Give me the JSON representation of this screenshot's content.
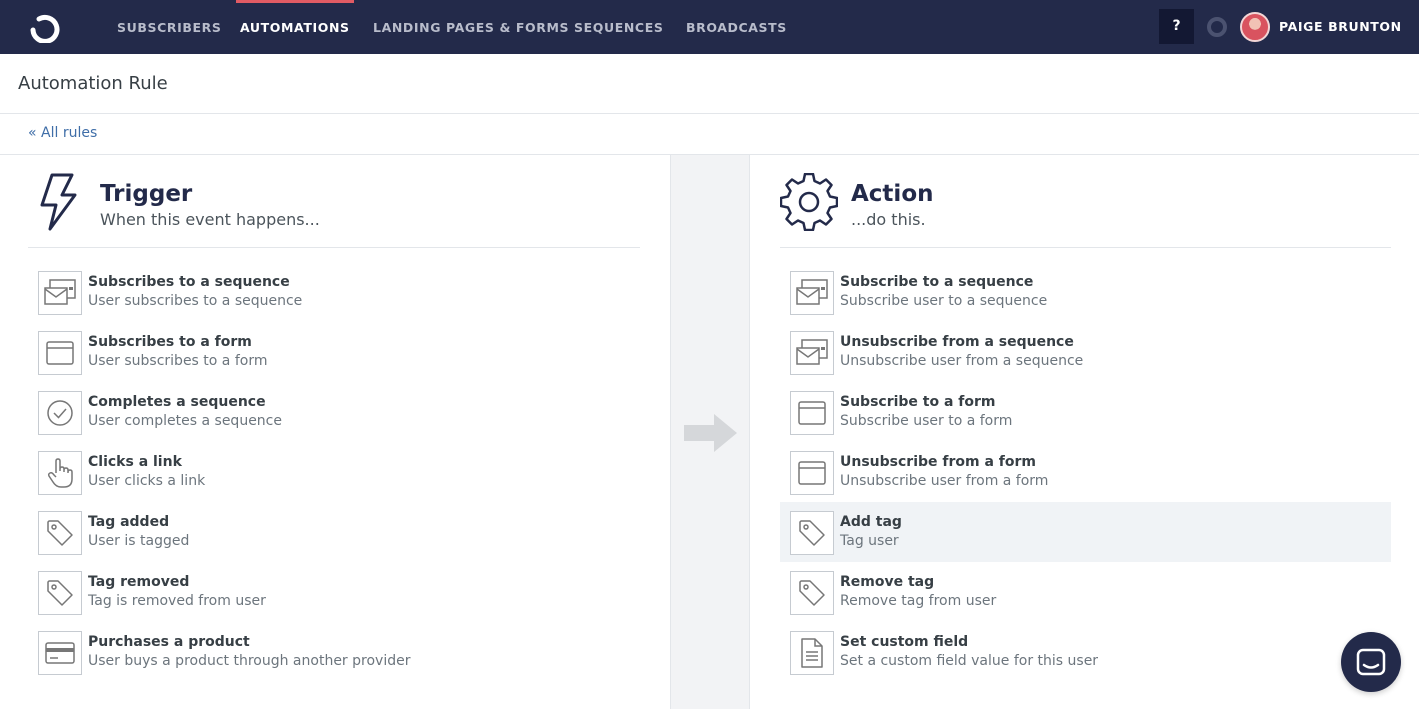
{
  "nav": {
    "items": [
      "SUBSCRIBERS",
      "AUTOMATIONS",
      "LANDING PAGES & FORMS",
      "SEQUENCES",
      "BROADCASTS"
    ],
    "active": "AUTOMATIONS",
    "help_label": "?",
    "user_name": "PAIGE BRUNTON"
  },
  "page": {
    "title": "Automation Rule",
    "back_link": "« All rules"
  },
  "trigger": {
    "title": "Trigger",
    "subtitle": "When this event happens...",
    "options": [
      {
        "title": "Subscribes to a sequence",
        "subtitle": "User subscribes to a sequence",
        "icon": "sequence-icon"
      },
      {
        "title": "Subscribes to a form",
        "subtitle": "User subscribes to a form",
        "icon": "form-icon"
      },
      {
        "title": "Completes a sequence",
        "subtitle": "User completes a sequence",
        "icon": "check-circle-icon"
      },
      {
        "title": "Clicks a link",
        "subtitle": "User clicks a link",
        "icon": "pointer-hand-icon"
      },
      {
        "title": "Tag added",
        "subtitle": "User is tagged",
        "icon": "tag-icon"
      },
      {
        "title": "Tag removed",
        "subtitle": "Tag is removed from user",
        "icon": "tag-icon"
      },
      {
        "title": "Purchases a product",
        "subtitle": "User buys a product through another provider",
        "icon": "credit-card-icon"
      }
    ]
  },
  "action": {
    "title": "Action",
    "subtitle": "...do this.",
    "selected": "Add tag",
    "options": [
      {
        "title": "Subscribe to a sequence",
        "subtitle": "Subscribe user to a sequence",
        "icon": "sequence-icon"
      },
      {
        "title": "Unsubscribe from a sequence",
        "subtitle": "Unsubscribe user from a sequence",
        "icon": "sequence-icon"
      },
      {
        "title": "Subscribe to a form",
        "subtitle": "Subscribe user to a form",
        "icon": "form-icon"
      },
      {
        "title": "Unsubscribe from a form",
        "subtitle": "Unsubscribe user from a form",
        "icon": "form-icon"
      },
      {
        "title": "Add tag",
        "subtitle": "Tag user",
        "icon": "tag-icon"
      },
      {
        "title": "Remove tag",
        "subtitle": "Remove tag from user",
        "icon": "tag-icon"
      },
      {
        "title": "Set custom field",
        "subtitle": "Set a custom field value for this user",
        "icon": "document-icon"
      }
    ]
  },
  "colors": {
    "nav_bg": "#232a4a",
    "active_underline": "#e15b64",
    "link": "#3f6ea8",
    "selected_row": "#f0f3f6"
  }
}
